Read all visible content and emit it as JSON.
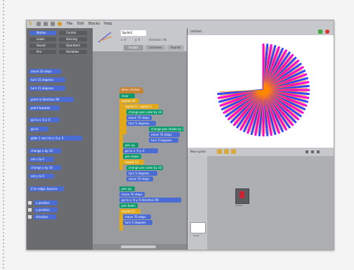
{
  "app": {
    "logo": "S",
    "menus": [
      "File",
      "Edit",
      "Blocks",
      "Help"
    ]
  },
  "palette": {
    "categories": [
      {
        "label": "Motion",
        "color": "#4a6cd4"
      },
      {
        "label": "Control",
        "color": "#e1a91a"
      },
      {
        "label": "Looks",
        "color": "#8a55d7"
      },
      {
        "label": "Sensing",
        "color": "#2ca5e2"
      },
      {
        "label": "Sound",
        "color": "#bb42c3"
      },
      {
        "label": "Operators",
        "color": "#5cb712"
      },
      {
        "label": "Pen",
        "color": "#0e9a6c"
      },
      {
        "label": "Variables",
        "color": "#ee7d16"
      }
    ],
    "blocks": [
      "move 10 steps",
      "turn 15 degrees",
      "turn 15 degrees",
      "point in direction 90",
      "point towards",
      "go to x: 0 y: 0",
      "go to",
      "glide 1 secs to x: 0 y: 0",
      "change x by 10",
      "set x to 0",
      "change y by 10",
      "set y to 0",
      "if on edge, bounce",
      "x position",
      "y position",
      "direction"
    ]
  },
  "sprite": {
    "name": "Sprite1",
    "x_label": "x: 0",
    "y_label": "y: 0",
    "direction_label": "direction: 90"
  },
  "tabs": [
    "Scripts",
    "Costumes",
    "Sounds"
  ],
  "scripts": {
    "hat": "when clicked",
    "blocks": [
      "clear",
      "repeat 10",
      "repeat 12",
      "change pen color by 10",
      "move 70 steps",
      "turn 5 degrees",
      "repeat 3",
      "change pen shade by 10",
      "move 70 steps",
      "turn 5 degrees",
      "pen up",
      "go to x: 0 y: 0",
      "pen down",
      "repeat 12",
      "change pen color by 10",
      "turn 5 degrees",
      "move 70 steps",
      "pen up",
      "move 70 steps",
      "go to x: 0 y: 0 direction 90",
      "pen down",
      "repeat 12",
      "move 70 steps",
      "turn 5 degrees"
    ]
  },
  "stage": {
    "title": "Untitled",
    "pattern_colors": [
      "#ff00cc",
      "#3344ff",
      "#ff8800"
    ]
  },
  "corral": {
    "label": "New sprite:",
    "stage_label": "Stage",
    "sprite_label": "Sprite1"
  }
}
